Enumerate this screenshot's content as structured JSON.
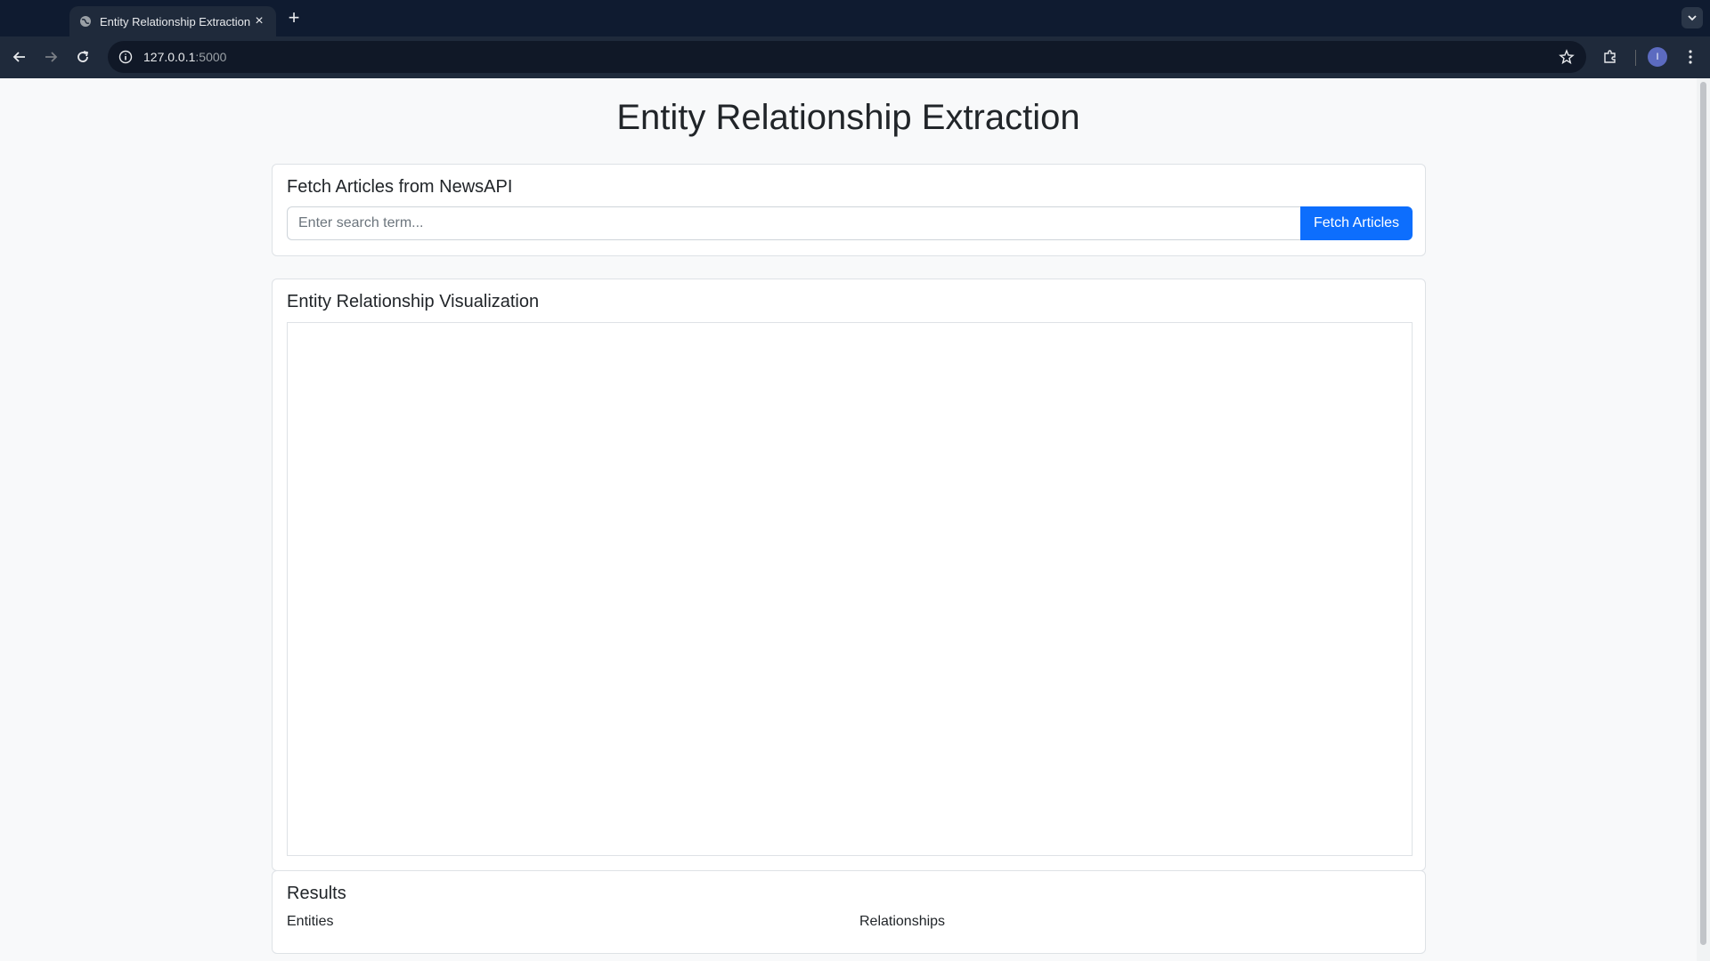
{
  "browser": {
    "tab_title": "Entity Relationship Extraction",
    "url_host": "127.0.0.1",
    "url_port": ":5000",
    "profile_initial": "I"
  },
  "page": {
    "title": "Entity Relationship Extraction",
    "fetch_card": {
      "heading": "Fetch Articles from NewsAPI",
      "search_placeholder": "Enter search term...",
      "search_value": "",
      "button_label": "Fetch Articles"
    },
    "viz_card": {
      "heading": "Entity Relationship Visualization"
    },
    "results_card": {
      "heading": "Results",
      "entities_label": "Entities",
      "relationships_label": "Relationships"
    }
  },
  "colors": {
    "accent": "#0d6efd",
    "background": "#f8f9fa",
    "chrome_dark": "#0f1b30"
  }
}
